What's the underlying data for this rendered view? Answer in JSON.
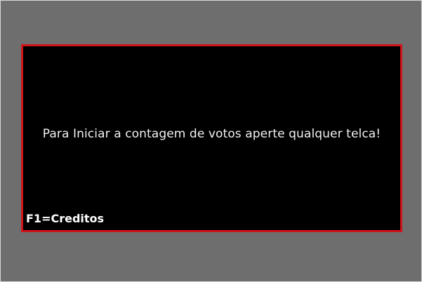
{
  "screen": {
    "prompt": "Para Iniciar a contagem de votos aperte qualquer telca!",
    "credits_hint": "F1=Creditos"
  },
  "colors": {
    "background": "#6e6e6e",
    "screen_background": "#000000",
    "screen_border": "#d0141a",
    "text": "#f2f2f2"
  }
}
